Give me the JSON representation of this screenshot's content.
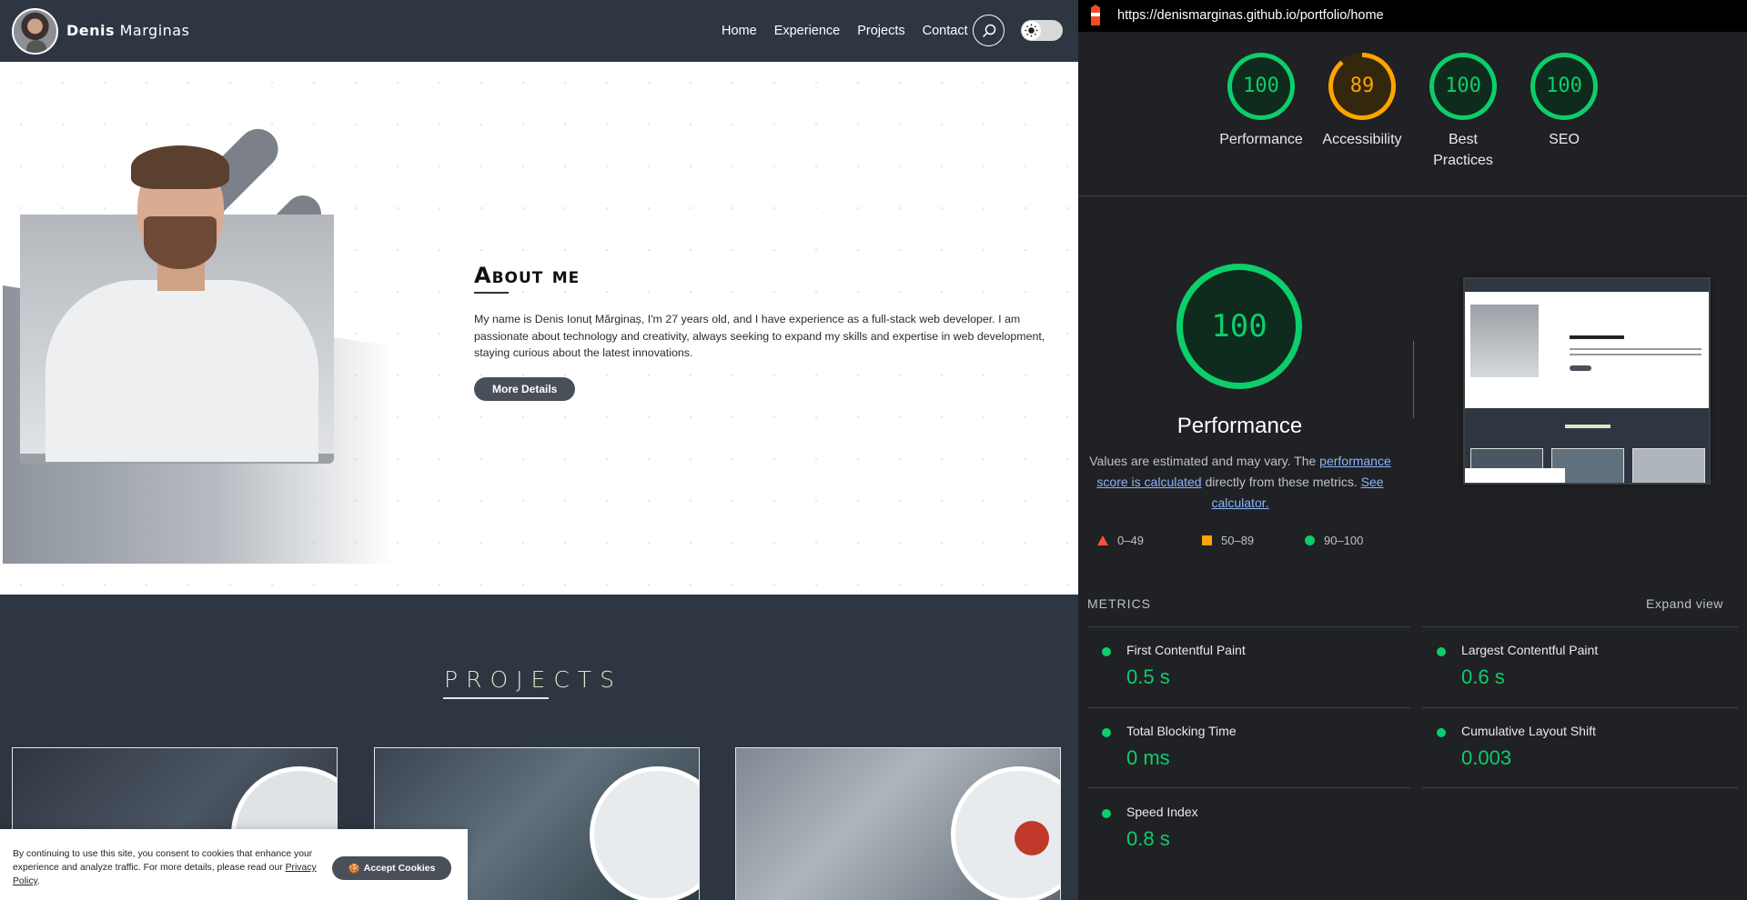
{
  "site": {
    "brand": {
      "first": "Denis",
      "last": "Marginas"
    },
    "nav": [
      "Home",
      "Experience",
      "Projects",
      "Contact"
    ],
    "about": {
      "title": "About me",
      "text": "My name is Denis Ionuț Mărginaș, I'm 27 years old, and I have experience as a full-stack web developer. I am passionate about technology and creativity, always seeking to expand my skills and expertise in web development, staying curious about the latest innovations.",
      "button": "More Details"
    },
    "projects_title": "PROJECTS",
    "cookie": {
      "text": "By continuing to use this site, you consent to cookies that enhance your experience and analyze traffic. For more details, please read our ",
      "link": "Privacy Policy",
      "end": ".",
      "button": "Accept Cookies"
    }
  },
  "lighthouse": {
    "url": "https://denismarginas.github.io/portfolio/home",
    "scores": [
      {
        "label": "Performance",
        "value": "100",
        "score": 100,
        "color": "#0cce6b"
      },
      {
        "label": "Accessibility",
        "value": "89",
        "score": 89,
        "color": "#ffa400"
      },
      {
        "label": "Best Practices",
        "value": "100",
        "score": 100,
        "color": "#0cce6b"
      },
      {
        "label": "SEO",
        "value": "100",
        "score": 100,
        "color": "#0cce6b"
      }
    ],
    "performance": {
      "value": "100",
      "title": "Performance",
      "desc_a": "Values are estimated and may vary. The ",
      "desc_link1": "performance score is calculated",
      "desc_b": " directly from these metrics. ",
      "desc_link2": "See calculator."
    },
    "legend": [
      "0–49",
      "50–89",
      "90–100"
    ],
    "metrics_header": "METRICS",
    "expand_label": "Expand view",
    "metrics": [
      {
        "name": "First Contentful Paint",
        "value": "0.5 s"
      },
      {
        "name": "Largest Contentful Paint",
        "value": "0.6 s"
      },
      {
        "name": "Total Blocking Time",
        "value": "0 ms"
      },
      {
        "name": "Cumulative Layout Shift",
        "value": "0.003"
      },
      {
        "name": "Speed Index",
        "value": "0.8 s"
      }
    ],
    "colors": {
      "pass": "#0cce6b",
      "average": "#ffa400",
      "fail": "#ff4e42"
    }
  }
}
